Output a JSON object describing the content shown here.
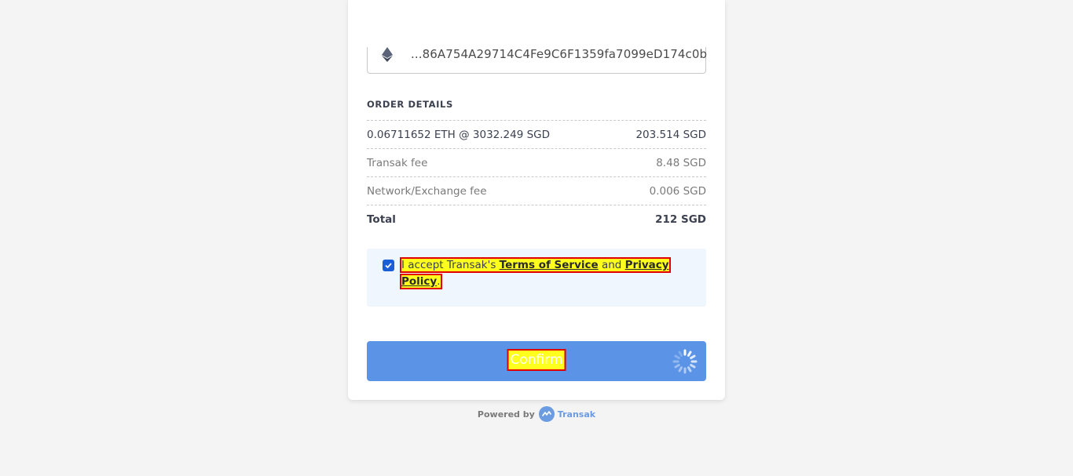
{
  "wallet": {
    "icon": "ethereum-icon",
    "address": "...86A754A29714C4Fe9C6F1359fa7099eD174c0b"
  },
  "order": {
    "title": "ORDER DETAILS",
    "rows": [
      {
        "label": "0.06711652 ETH @ 3032.249 SGD",
        "value": "203.514 SGD"
      },
      {
        "label": "Transak fee",
        "value": "8.48 SGD"
      },
      {
        "label": "Network/Exchange fee",
        "value": "0.006 SGD"
      },
      {
        "label": "Total",
        "value": "212 SGD"
      }
    ]
  },
  "terms": {
    "checked": true,
    "prefix": "I accept Transak's ",
    "terms_link": "Terms of Service",
    "middle": " and ",
    "privacy_link": "Privacy Policy",
    "suffix": "."
  },
  "confirm": {
    "label": "Confirm"
  },
  "footer": {
    "powered_by": "Powered by",
    "brand": "Transak"
  },
  "colors": {
    "accent": "#5b93e6",
    "checkbox": "#1a5fd6",
    "highlight": "#ffff1e",
    "highlight_border": "#e00000"
  }
}
